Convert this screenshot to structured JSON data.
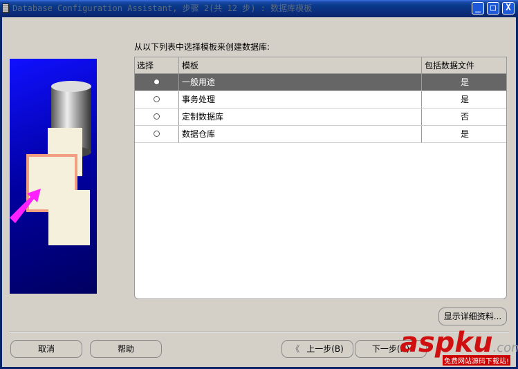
{
  "window": {
    "title": "Database Configuration Assistant, 步骤 2(共 12 步) : 数据库模板",
    "controls": {
      "minimize": "_",
      "maximize": "□",
      "close": "X"
    }
  },
  "prompt": "从以下列表中选择模板来创建数据库:",
  "table": {
    "columns": [
      "选择",
      "模板",
      "包括数据文件"
    ],
    "rows": [
      {
        "template": "一般用途",
        "includes_datafiles": "是",
        "selected": true
      },
      {
        "template": "事务处理",
        "includes_datafiles": "是",
        "selected": false
      },
      {
        "template": "定制数据库",
        "includes_datafiles": "否",
        "selected": false
      },
      {
        "template": "数据仓库",
        "includes_datafiles": "是",
        "selected": false
      }
    ]
  },
  "buttons": {
    "details": "显示详细资料...",
    "cancel": "取消",
    "help": "帮助",
    "back": "上一步(B)",
    "back_icon": "《",
    "next": "下一步(N)"
  },
  "watermark": {
    "logo": "aspku",
    "suffix": ".com",
    "tagline": "免费网站源码下载站!"
  }
}
